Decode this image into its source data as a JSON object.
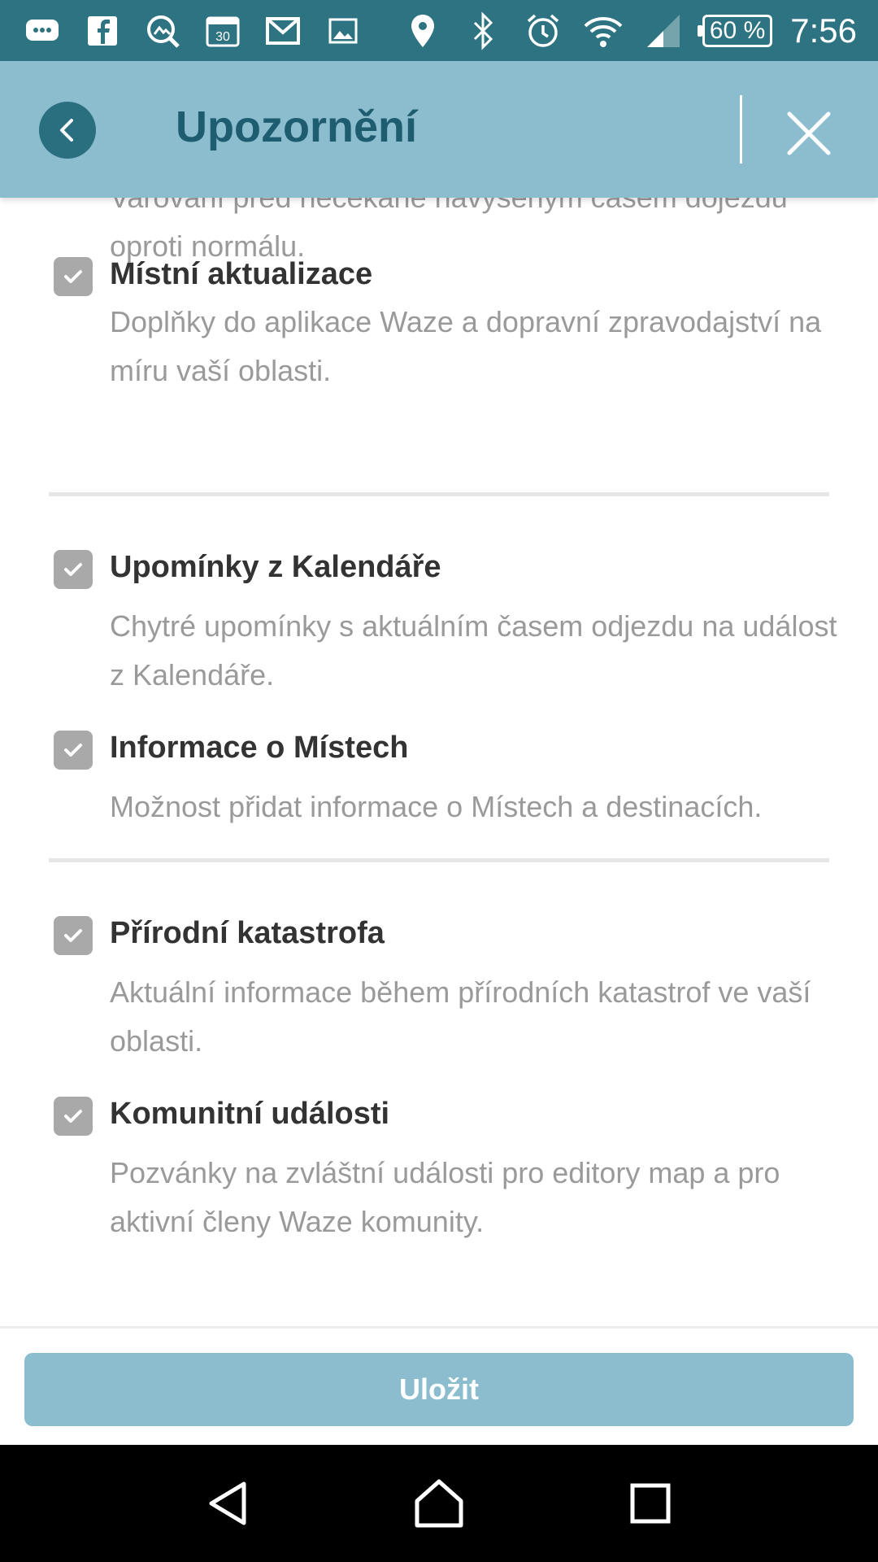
{
  "status_bar": {
    "battery": "60 %",
    "time": "7:56",
    "left_icons": [
      "messenger-icon",
      "facebook-icon",
      "search-icon",
      "calendar-icon",
      "gmail-icon",
      "image-icon"
    ],
    "right_icons": [
      "location-icon",
      "bluetooth-icon",
      "alarm-icon",
      "wifi-icon",
      "signal-icon"
    ]
  },
  "header": {
    "title": "Upozornění",
    "back_icon": "chevron-left-icon",
    "close_icon": "close-icon"
  },
  "intro": {
    "desc": "Varování před nečekaně navýšeným časem dojezdu oproti normálu."
  },
  "options": [
    {
      "title": "Místní aktualizace",
      "desc": "Doplňky do aplikace Waze a dopravní zpravodajství na míru vaší oblasti.",
      "checked": true
    },
    {
      "title": "Upomínky z Kalendáře",
      "desc": "Chytré upomínky s aktuálním časem odjezdu na událost z Kalendáře.",
      "checked": true
    },
    {
      "title": "Informace o Místech",
      "desc": "Možnost přidat informace o Místech a destinacích.",
      "checked": true
    },
    {
      "title": "Přírodní katastrofa",
      "desc": "Aktuální informace během přírodních katastrof ve vaší oblasti.",
      "checked": true
    },
    {
      "title": "Komunitní události",
      "desc": "Pozvánky na zvláštní události pro editory map a pro aktivní členy Waze komunity.",
      "checked": true
    }
  ],
  "footer": {
    "save_label": "Uložit"
  },
  "colors": {
    "status_bar": "#2d7382",
    "header": "#8bbdce",
    "accent": "#1e5d6f",
    "checkbox": "#a9a9a9"
  }
}
